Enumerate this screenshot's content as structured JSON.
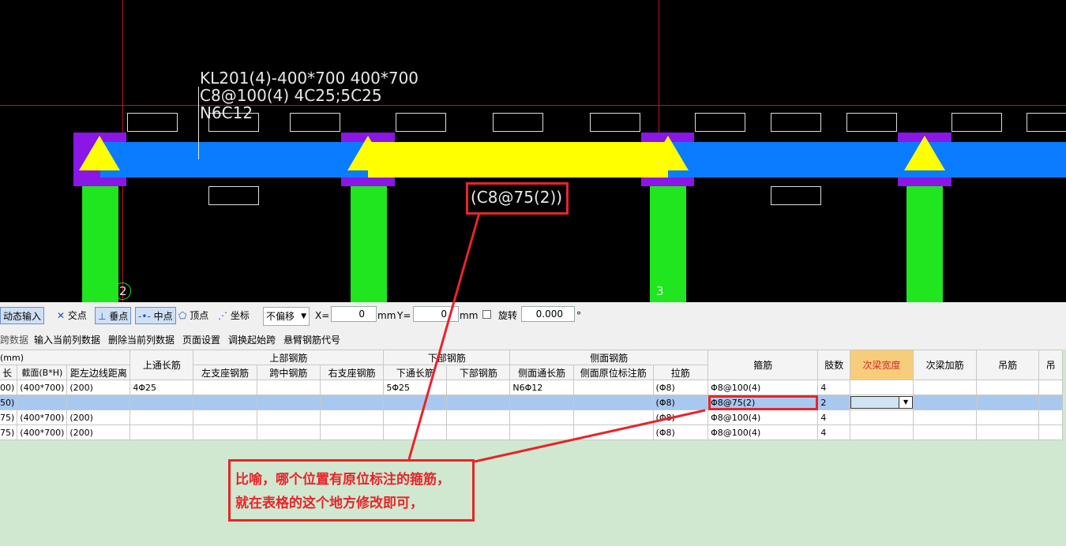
{
  "cad": {
    "beam_label_line1": "KL201(4)-400*700 400*700",
    "beam_label_line2": "C8@100(4) 4C25;5C25",
    "beam_label_line3": "N6C12",
    "stirrup_annotation": "(C8@75(2))",
    "axis_label_2": "2",
    "axis_label_3": "3",
    "colors": {
      "beam": "#0a7cff",
      "column": "#1fe61f",
      "support": "#8a17e6",
      "highlight": "#ffff00",
      "annotation": "#e8242a"
    }
  },
  "toolbar": {
    "dynamic_input": "动态输入",
    "intersection": "交点",
    "perpendicular": "垂点",
    "midpoint": "中点",
    "vertex": "顶点",
    "coordinate": "坐标",
    "offset_value": "不偏移",
    "x_label": "X=",
    "x_value": "0",
    "unit1": "mm",
    "y_label": "Y=",
    "y_value": "0",
    "unit2": "mm",
    "rotate_label": "旋转",
    "rotate_value": "0.000",
    "degree": "°"
  },
  "menubar": {
    "item0": "跨数据",
    "item1": "输入当前列数据",
    "item2": "删除当前列数据",
    "item3": "页面设置",
    "item4": "调换起始跨",
    "item5": "悬臂钢筋代号"
  },
  "table": {
    "group_unit": "(mm)",
    "group_top": "上部钢筋",
    "group_bottom": "下部钢筋",
    "group_side": "侧面钢筋",
    "headers": {
      "h0": "长",
      "h1": "截面(B*H)",
      "h2": "距左边线距离",
      "h3": "上通长筋",
      "h4": "左支座钢筋",
      "h5": "跨中钢筋",
      "h6": "右支座钢筋",
      "h7": "下通长筋",
      "h8": "下部钢筋",
      "h9": "侧面通长筋",
      "h10": "侧面原位标注筋",
      "h11": "拉筋",
      "h12": "箍筋",
      "h13": "肢数",
      "h14": "次梁宽度",
      "h15": "次梁加筋",
      "h16": "吊筋",
      "h17": "吊"
    },
    "rows": [
      {
        "c0": "00)",
        "c1": "(400*700)",
        "c2": "(200)",
        "c3": "4Φ25",
        "c7": "5Φ25",
        "c9": "N6Φ12",
        "c11": "(Φ8)",
        "c12": "Φ8@100(4)",
        "c13": "4"
      },
      {
        "c0": "50)",
        "c1": "(400*700)",
        "c2": "(200)",
        "c3": "",
        "c7": "",
        "c9": "",
        "c11": "(Φ8)",
        "c12": "Φ8@75(2)",
        "c13": "2"
      },
      {
        "c0": "75)",
        "c1": "(400*700)",
        "c2": "(200)",
        "c3": "",
        "c7": "",
        "c9": "",
        "c11": "(Φ8)",
        "c12": "Φ8@100(4)",
        "c13": "4"
      },
      {
        "c0": "75)",
        "c1": "(400*700)",
        "c2": "(200)",
        "c3": "",
        "c7": "",
        "c9": "",
        "c11": "(Φ8)",
        "c12": "Φ8@100(4)",
        "c13": "4"
      }
    ]
  },
  "note": {
    "line1": "比喻，哪个位置有原位标注的箍筋，",
    "line2": "就在表格的这个地方修改即可，"
  }
}
